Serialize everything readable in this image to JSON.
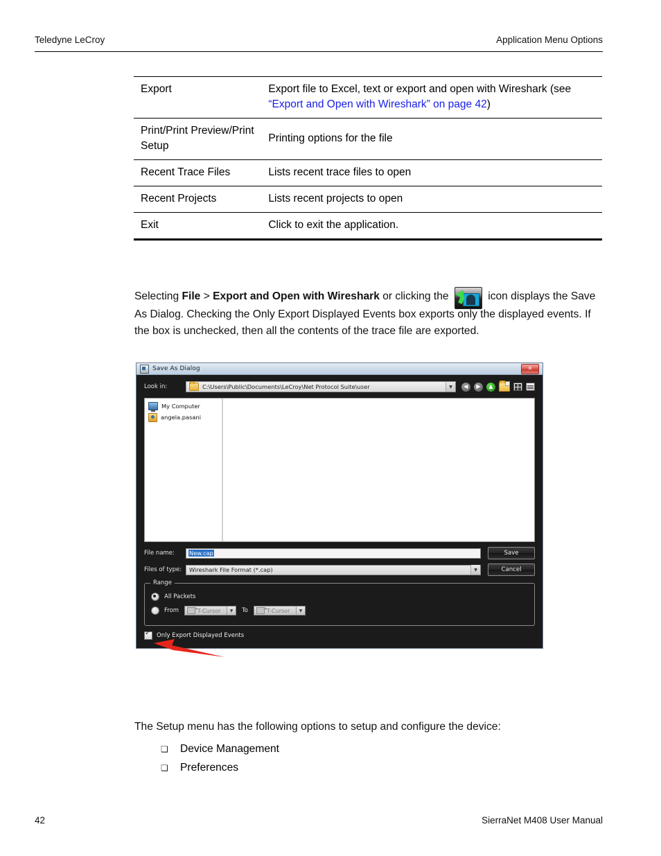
{
  "header": {
    "left": "Teledyne LeCroy",
    "right": "Application Menu Options"
  },
  "menu_table": {
    "rows": [
      {
        "label": "Export",
        "desc_before": "Export file to Excel, text or export and open with Wireshark (see ",
        "desc_link": "“Export and Open with Wireshark” on page 42",
        "desc_after": ")"
      },
      {
        "label": "Print/Print Preview/Print Setup",
        "desc": "Printing options for the file"
      },
      {
        "label": "Recent Trace Files",
        "desc": "Lists recent trace files to open"
      },
      {
        "label": "Recent Projects",
        "desc": "Lists recent projects to open"
      },
      {
        "label": "Exit",
        "desc": "Click to exit the application."
      }
    ]
  },
  "wireshark_para": {
    "seg1": "Selecting ",
    "bold1": "File",
    "seg2": " > ",
    "bold2": "Export and Open with Wireshark",
    "seg3": " or clicking the ",
    "icon_name": "wireshark-export-icon",
    "seg4": " icon displays the Save As Dialog. Checking the Only Export Displayed Events box exports only the displayed events. If the box is unchecked, then all the contents of the trace file are exported."
  },
  "dialog": {
    "title": "Save As Dialog",
    "close_label": "✕",
    "look_in_label": "Look in:",
    "path": "C:\\Users\\Public\\Documents\\LeCroy\\Net Protocol Suite\\user",
    "combo_arrow": "▼",
    "nav": {
      "back": "◀",
      "forward": "▶",
      "up": "▲",
      "new_folder_name": "new-folder-icon",
      "tiles_view_name": "tiles-view-icon",
      "list_view_name": "list-view-icon"
    },
    "places": [
      {
        "label": "My Computer",
        "icon": "my-computer-icon"
      },
      {
        "label": "angela.pasani",
        "icon": "user-folder-icon"
      }
    ],
    "file_name_label": "File name:",
    "file_name_value": "New.cap",
    "files_of_type_label": "Files of type:",
    "files_of_type_value": "Wireshark File Format (*.cap)",
    "save_label": "Save",
    "cancel_label": "Cancel",
    "range": {
      "legend": "Range",
      "all_packets": "All Packets",
      "from_label": "From",
      "to_label": "To",
      "from_value": "T-Cursor",
      "to_value": "T-Cursor"
    },
    "only_export_label": "Only Export Displayed Events"
  },
  "setup_para": {
    "text": "The Setup menu has the following options to setup and configure the device:"
  },
  "bullets": {
    "glyph": "❑",
    "items": [
      {
        "label": "Device Management"
      },
      {
        "label": "Preferences"
      }
    ]
  },
  "footer": {
    "page_number": "42",
    "manual_title": "SierraNet M408 User Manual"
  },
  "colors": {
    "link": "#1a20e8",
    "annotation_arrow": "#e8251c",
    "dialog_background": "#1b1b1b",
    "titlebar": "#cfdcea"
  }
}
